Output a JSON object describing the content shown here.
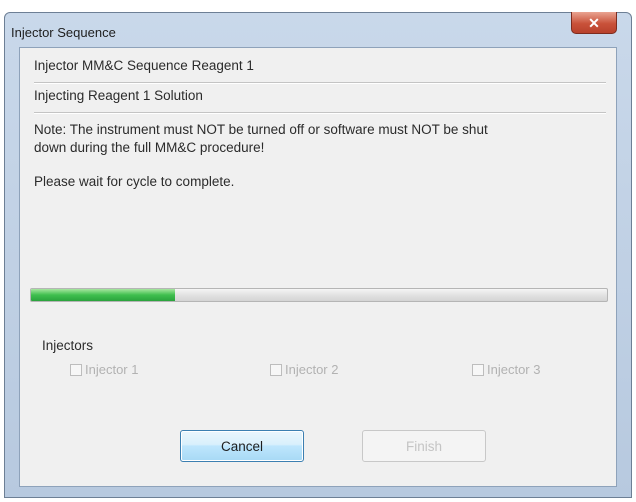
{
  "window": {
    "title": "Injector Sequence",
    "close_icon": "close-icon"
  },
  "dialog": {
    "heading": "Injector MM&C Sequence Reagent 1",
    "status": "Injecting Reagent 1 Solution",
    "note_line1": "Note: The instrument must NOT be turned off or software must NOT be shut",
    "note_line2": "down during the full MM&C procedure!",
    "wait_message": "Please wait for cycle to complete."
  },
  "progress": {
    "fraction": 0.25,
    "fill_color": "#3fbf4e"
  },
  "injectors": {
    "label": "Injectors",
    "items": [
      {
        "label": "Injector 1",
        "checked": false,
        "enabled": false
      },
      {
        "label": "Injector 2",
        "checked": false,
        "enabled": false
      },
      {
        "label": "Injector 3",
        "checked": false,
        "enabled": false
      }
    ]
  },
  "buttons": {
    "cancel_label": "Cancel",
    "finish_label": "Finish"
  }
}
